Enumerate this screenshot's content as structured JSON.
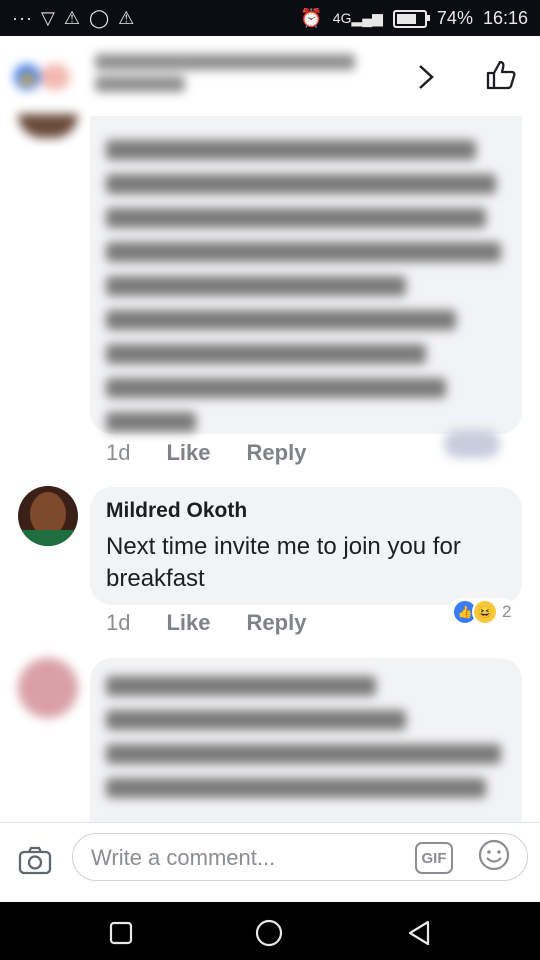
{
  "status_bar": {
    "left_icons": [
      "more-icon",
      "vpn-icon",
      "warning-icon",
      "whatsapp-icon",
      "warning-icon"
    ],
    "alarm_icon": "alarm-icon",
    "network_label": "4G",
    "battery_percent": "74%",
    "battery_level": 0.74,
    "time": "16:16"
  },
  "comments": [
    {
      "meta": {
        "age": "1d",
        "like_label": "Like",
        "reply_label": "Reply"
      }
    },
    {
      "author": "Mildred Okoth",
      "text": "Next time invite me to join you for breakfast",
      "reaction_count": "2",
      "reactions": [
        "like",
        "haha"
      ],
      "meta": {
        "age": "1d",
        "like_label": "Like",
        "reply_label": "Reply"
      }
    }
  ],
  "composer": {
    "placeholder": "Write a comment...",
    "gif_label": "GIF"
  },
  "colors": {
    "like_blue": "#3b7cf4",
    "bubble_bg": "#f2f3f5",
    "meta_text": "#8a8d91"
  }
}
